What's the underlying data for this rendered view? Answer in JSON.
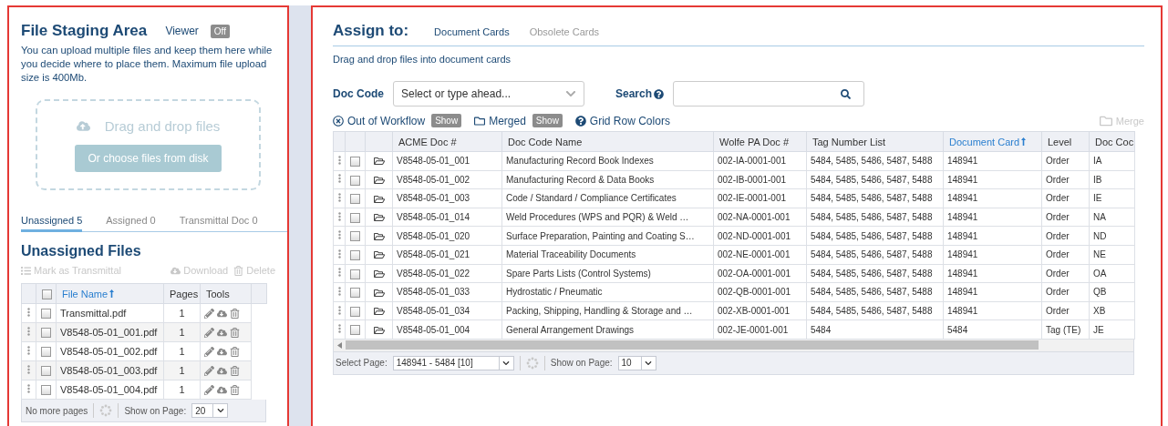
{
  "staging": {
    "title": "File Staging Area",
    "viewer": {
      "label": "Viewer",
      "value": "Off",
      "on": false
    },
    "description": "You can upload multiple files and keep them here while you decide where to place them. Maximum file upload size is 400Mb.",
    "dropzone": {
      "title": "Drag and drop files",
      "button": "Or choose files from disk",
      "disabled": true
    },
    "tabs": [
      {
        "label": "Unassigned 5",
        "selected": true
      },
      {
        "label": "Assigned 0",
        "selected": false
      },
      {
        "label": "Transmittal Doc 0",
        "selected": false
      }
    ],
    "section_title": "Unassigned Files",
    "actions": [
      {
        "kind": "list",
        "label": "Mark as Transmittal",
        "disabled": true
      },
      {
        "kind": "download",
        "label": "Download",
        "disabled": true
      },
      {
        "kind": "delete",
        "label": "Delete",
        "disabled": true
      }
    ],
    "table": {
      "all_checked": false,
      "columns": [
        {
          "label": "File Name",
          "sorted": true
        },
        {
          "label": "Pages",
          "sorted": false
        },
        {
          "label": "Tools",
          "sorted": false
        }
      ],
      "rows": [
        {
          "name": "Transmittal.pdf",
          "pages": "1",
          "checked": false
        },
        {
          "name": "V8548-05-01_001.pdf",
          "pages": "1",
          "checked": false
        },
        {
          "name": "V8548-05-01_002.pdf",
          "pages": "1",
          "checked": false
        },
        {
          "name": "V8548-05-01_003.pdf",
          "pages": "1",
          "checked": false
        },
        {
          "name": "V8548-05-01_004.pdf",
          "pages": "1",
          "checked": false
        }
      ],
      "footer": {
        "status": "No more pages",
        "show_label": "Show on Page:",
        "show_value": "20"
      }
    }
  },
  "assign": {
    "title": "Assign to:",
    "tabs": [
      {
        "label": "Document Cards",
        "selected": true
      },
      {
        "label": "Obsolete Cards",
        "selected": false
      }
    ],
    "hint": "Drag and drop files into document cards",
    "doc_code": {
      "label": "Doc Code",
      "placeholder": "Select or type ahead..."
    },
    "search": {
      "label": "Search"
    },
    "toggles": [
      {
        "kind": "workflow",
        "label": "Out of Workflow",
        "badge": "Show",
        "on": false
      },
      {
        "kind": "merged",
        "label": "Merged",
        "badge": "Show",
        "on": false
      },
      {
        "kind": "help",
        "label": "Grid Row Colors"
      }
    ],
    "merge": {
      "label": "Merge",
      "disabled": true
    },
    "table": {
      "columns": [
        {
          "label": "ACME Doc #",
          "sorted": false
        },
        {
          "label": "Doc Code Name",
          "sorted": false
        },
        {
          "label": "Wolfe PA Doc #",
          "sorted": false
        },
        {
          "label": "Tag Number List",
          "sorted": false
        },
        {
          "label": "Document Card",
          "sorted": true
        },
        {
          "label": "Level",
          "sorted": false
        },
        {
          "label": "Doc Coc",
          "sorted": false
        }
      ],
      "rows": [
        {
          "checked": false,
          "cells": [
            "V8548-05-01_001",
            "Manufacturing Record Book Indexes",
            "002-IA-0001-001",
            "5484, 5485, 5486, 5487, 5488",
            "148941",
            "Order",
            "IA"
          ]
        },
        {
          "checked": false,
          "cells": [
            "V8548-05-01_002",
            "Manufacturing Record & Data Books",
            "002-IB-0001-001",
            "5484, 5485, 5486, 5487, 5488",
            "148941",
            "Order",
            "IB"
          ]
        },
        {
          "checked": false,
          "cells": [
            "V8548-05-01_003",
            "Code / Standard / Compliance Certificates",
            "002-IE-0001-001",
            "5484, 5485, 5486, 5487, 5488",
            "148941",
            "Order",
            "IE"
          ]
        },
        {
          "checked": false,
          "cells": [
            "V8548-05-01_014",
            "Weld Procedures (WPS and PQR) & Weld …",
            "002-NA-0001-001",
            "5484, 5485, 5486, 5487, 5488",
            "148941",
            "Order",
            "NA"
          ]
        },
        {
          "checked": false,
          "cells": [
            "V8548-05-01_020",
            "Surface Preparation, Painting and Coating S…",
            "002-ND-0001-001",
            "5484, 5485, 5486, 5487, 5488",
            "148941",
            "Order",
            "ND"
          ]
        },
        {
          "checked": false,
          "cells": [
            "V8548-05-01_021",
            "Material Traceability Documents",
            "002-NE-0001-001",
            "5484, 5485, 5486, 5487, 5488",
            "148941",
            "Order",
            "NE"
          ]
        },
        {
          "checked": false,
          "cells": [
            "V8548-05-01_022",
            "Spare Parts Lists (Control Systems)",
            "002-OA-0001-001",
            "5484, 5485, 5486, 5487, 5488",
            "148941",
            "Order",
            "OA"
          ]
        },
        {
          "checked": false,
          "cells": [
            "V8548-05-01_033",
            "Hydrostatic / Pneumatic",
            "002-QB-0001-001",
            "5484, 5485, 5486, 5487, 5488",
            "148941",
            "Order",
            "QB"
          ]
        },
        {
          "checked": false,
          "cells": [
            "V8548-05-01_034",
            "Packing, Shipping, Handling & Storage and …",
            "002-XB-0001-001",
            "5484, 5485, 5486, 5487, 5488",
            "148941",
            "Order",
            "XB"
          ]
        },
        {
          "checked": false,
          "cells": [
            "V8548-05-01_004",
            "General Arrangement Drawings",
            "002-JE-0001-001",
            "5484",
            "5484",
            "Tag (TE)",
            "JE"
          ]
        }
      ],
      "footer": {
        "select_label": "Select Page:",
        "select_value": "148941 - 5484 [10]",
        "show_label": "Show on Page:",
        "show_value": "10"
      }
    }
  }
}
